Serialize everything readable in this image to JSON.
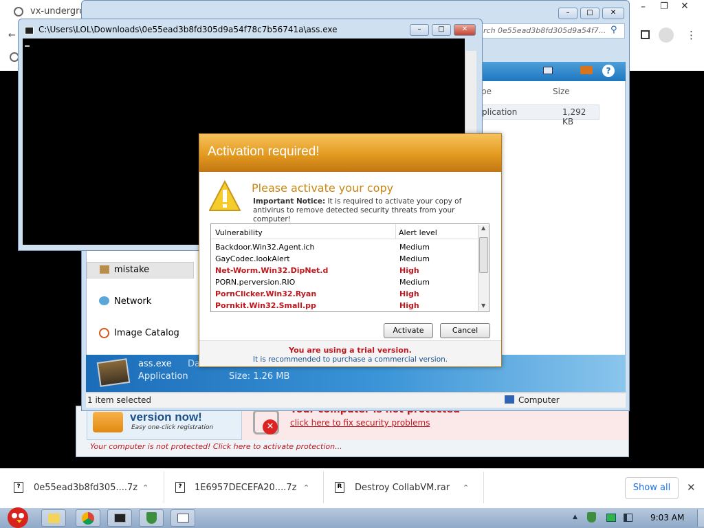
{
  "browser": {
    "tab_title": "vx-undergro",
    "search_placeholder": "rch 0e55ead3b8fd305d9a54f7..."
  },
  "console": {
    "title": "C:\\Users\\LOL\\Downloads\\0e55ead3b8fd305d9a54f78c7b56741a\\ass.exe"
  },
  "explorer": {
    "columns": {
      "type": "pe",
      "size": "Size"
    },
    "file_row": {
      "type": "plication",
      "size": "1,292 KB"
    },
    "nav_items": [
      "mistake",
      "Network",
      "Image Catalog"
    ],
    "details": {
      "name": "ass.exe",
      "date_prefix": "Da",
      "type": "Application",
      "size": "Size: 1.26 MB"
    },
    "status_left": "1 item selected",
    "status_right": "Computer"
  },
  "dialog": {
    "title": "Activation required!",
    "heading": "Please activate your copy",
    "notice_bold": "Important Notice:",
    "notice_text": " It is required to activate your copy of antivirus to remove detected security threats from your computer!",
    "columns": {
      "name": "Vulnerability",
      "level": "Alert level"
    },
    "rows": [
      {
        "name": "Backdoor.Win32.Agent.ich",
        "level": "Medium"
      },
      {
        "name": "GayCodec.lookAlert",
        "level": "Medium"
      },
      {
        "name": "Net-Worm.Win32.DipNet.d",
        "level": "High"
      },
      {
        "name": "PORN.perversion.RIO",
        "level": "Medium"
      },
      {
        "name": "PornClicker.Win32.Ryan",
        "level": "High"
      },
      {
        "name": "Pornkit.Win32.Small.pp",
        "level": "High"
      }
    ],
    "activate_label": "Activate",
    "cancel_label": "Cancel",
    "footer_warning": "You are using a trial version.",
    "footer_note": "It is recommended to purchase a commercial version."
  },
  "antivirus_bg": {
    "ad_title": "version now!",
    "ad_subtitle": "Easy one-click registration",
    "warning_title": "Your computer is not protected",
    "warning_link": "click here to fix security problems",
    "bottom_text": "Your computer is not protected! Click here to activate protection..."
  },
  "downloads": {
    "items": [
      "0e55ead3b8fd305....7z",
      "1E6957DECEFA20....7z",
      "Destroy CollabVM.rar"
    ],
    "show_all_label": "Show all"
  },
  "taskbar": {
    "clock": "9:03 AM"
  },
  "colors": {
    "dialog_header": "#e39a1e",
    "high_alert": "#c0161c",
    "heading_orange": "#c8850f"
  }
}
